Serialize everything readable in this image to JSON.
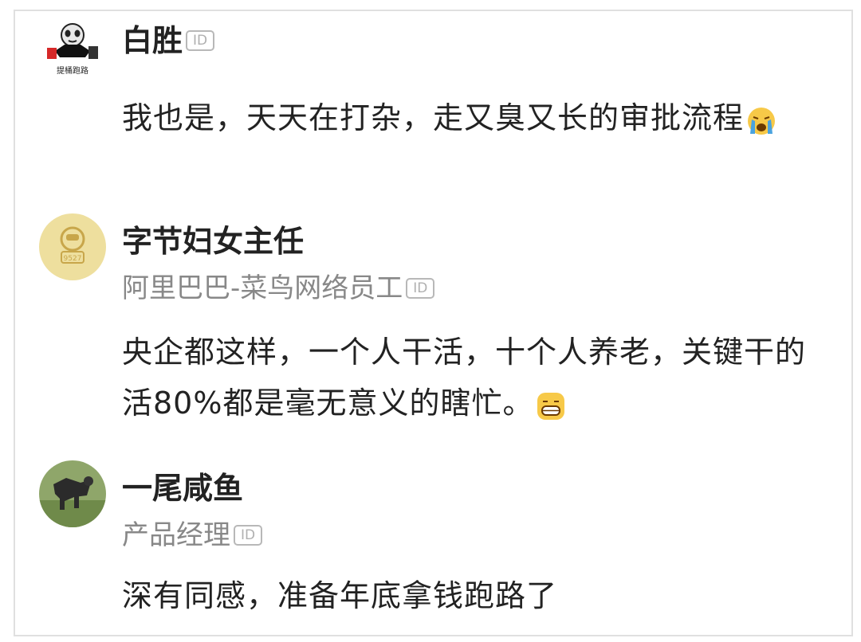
{
  "comments": [
    {
      "author": "白胜",
      "avatar_caption": "提桶跑路",
      "badge": "ID",
      "subtitle": "",
      "text": "我也是，天天在打杂，走又臭又长的审批流程",
      "emoji": "crying-face-icon"
    },
    {
      "author": "字节妇女主任",
      "avatar_caption": "9527",
      "badge": "ID",
      "subtitle": "阿里巴巴-菜鸟网络员工",
      "text": "央企都这样，一个人干活，十个人养老，关键干的活80%都是毫无意义的瞎忙。",
      "emoji": "grin-face-icon"
    },
    {
      "author": "一尾咸鱼",
      "avatar_caption": "",
      "badge": "ID",
      "subtitle": "产品经理",
      "text": "深有同感，准备年底拿钱跑路了",
      "emoji": ""
    }
  ],
  "colors": {
    "text": "#222222",
    "subtitle": "#888888",
    "badge": "#b0b0b0",
    "border": "#e0e0e0",
    "avatar2_bg": "#eedf9e"
  }
}
